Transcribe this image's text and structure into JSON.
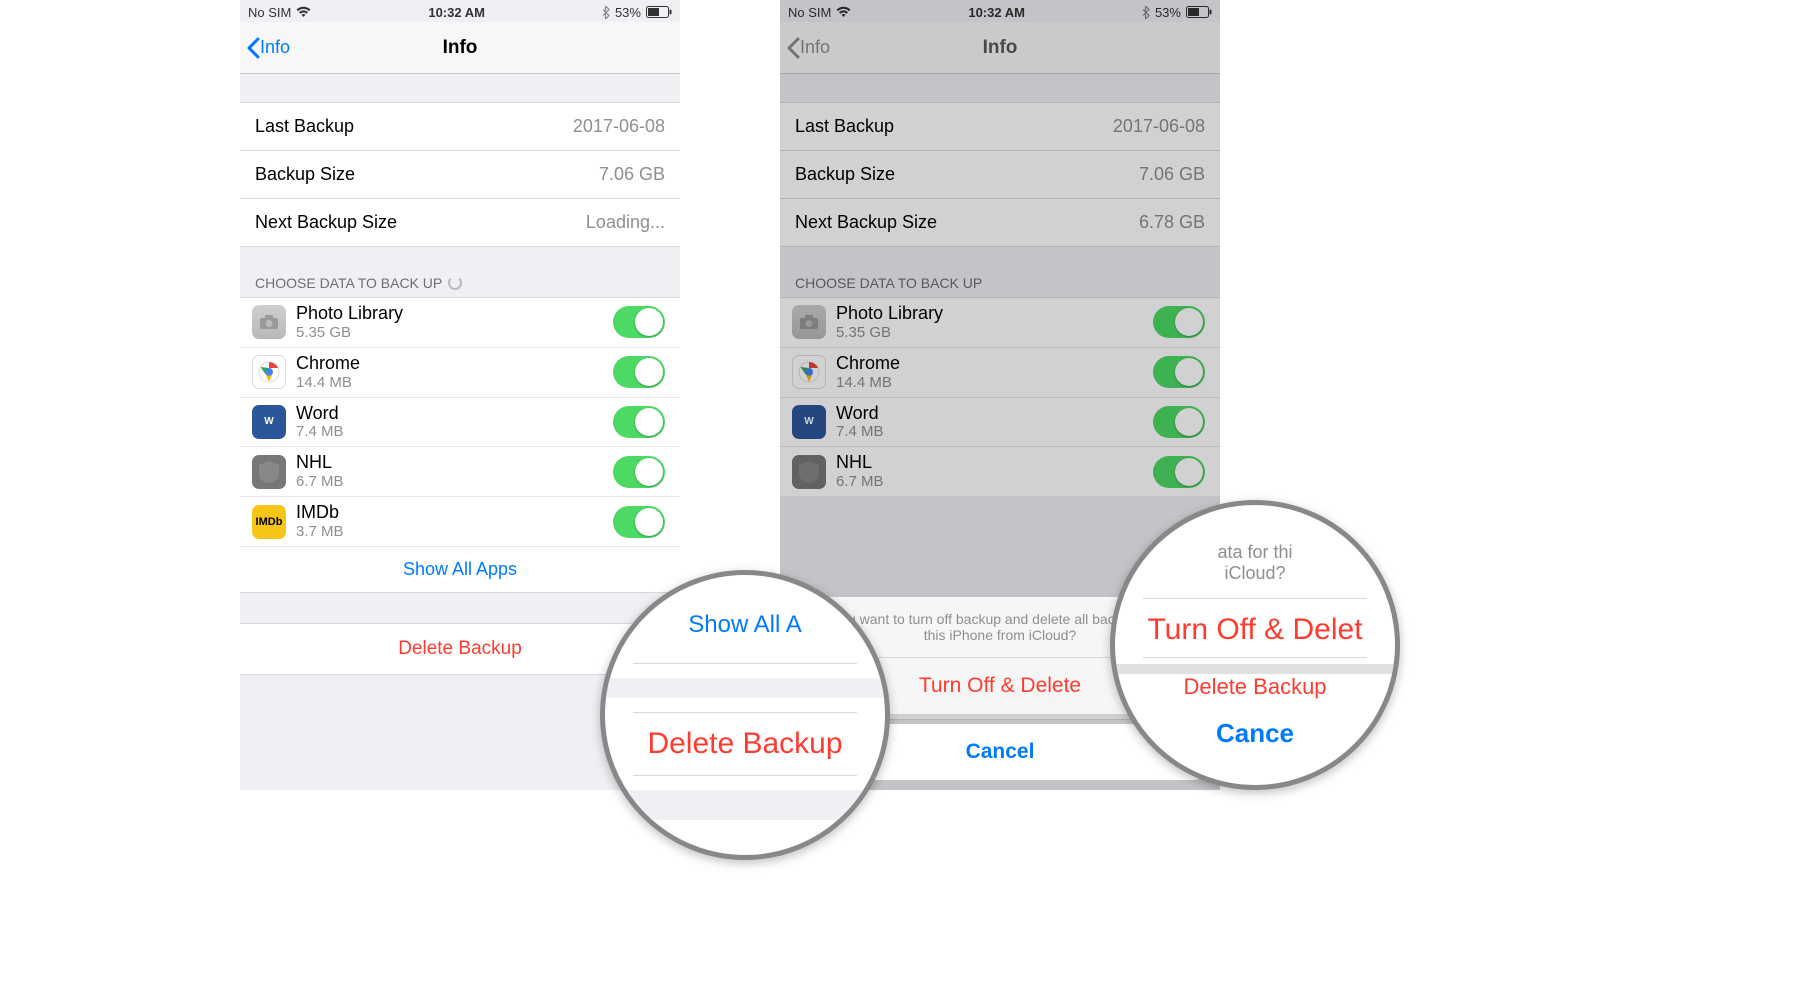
{
  "status": {
    "carrier": "No SIM",
    "time": "10:32 AM",
    "battery_pct": "53%"
  },
  "nav": {
    "back_label": "Info",
    "title": "Info"
  },
  "backup_info_a": {
    "last_label": "Last Backup",
    "last_value": "2017-06-08",
    "size_label": "Backup Size",
    "size_value": "7.06 GB",
    "next_label": "Next Backup Size",
    "next_value": "Loading..."
  },
  "backup_info_b": {
    "last_label": "Last Backup",
    "last_value": "2017-06-08",
    "size_label": "Backup Size",
    "size_value": "7.06 GB",
    "next_label": "Next Backup Size",
    "next_value": "6.78 GB"
  },
  "section_header": "CHOOSE DATA TO BACK UP",
  "apps": [
    {
      "name": "Photo Library",
      "size": "5.35 GB",
      "icon": "photos"
    },
    {
      "name": "Chrome",
      "size": "14.4 MB",
      "icon": "chrome"
    },
    {
      "name": "Word",
      "size": "7.4 MB",
      "icon": "word"
    },
    {
      "name": "NHL",
      "size": "6.7 MB",
      "icon": "nhl"
    },
    {
      "name": "IMDb",
      "size": "3.7 MB",
      "icon": "imdb",
      "icon_text": "IMDb"
    }
  ],
  "show_all": "Show All Apps",
  "delete_label": "Delete Backup",
  "sheet": {
    "message": "Do you want to turn off backup and delete all backup data for this iPhone from iCloud?",
    "message_frag1": "Do you want",
    "message_frag2": "ata for thi",
    "message_frag3": "p and delete",
    "message_frag4": "all ba",
    "message_frag5": "iCloud?",
    "message_frag6": "e from",
    "action": "Turn Off & Delete",
    "cancel": "Cancel"
  },
  "magnifier_a": {
    "top_frag": "Show All A",
    "main": "Delete Backup"
  },
  "magnifier_b": {
    "main": "Turn Off & Delet",
    "strike": "Delete Backup",
    "cancel": "Cance"
  },
  "colors": {
    "ios_blue": "#007aff",
    "ios_red": "#ff3b30",
    "ios_green": "#4cd964",
    "ios_gray": "#8e8e93"
  }
}
